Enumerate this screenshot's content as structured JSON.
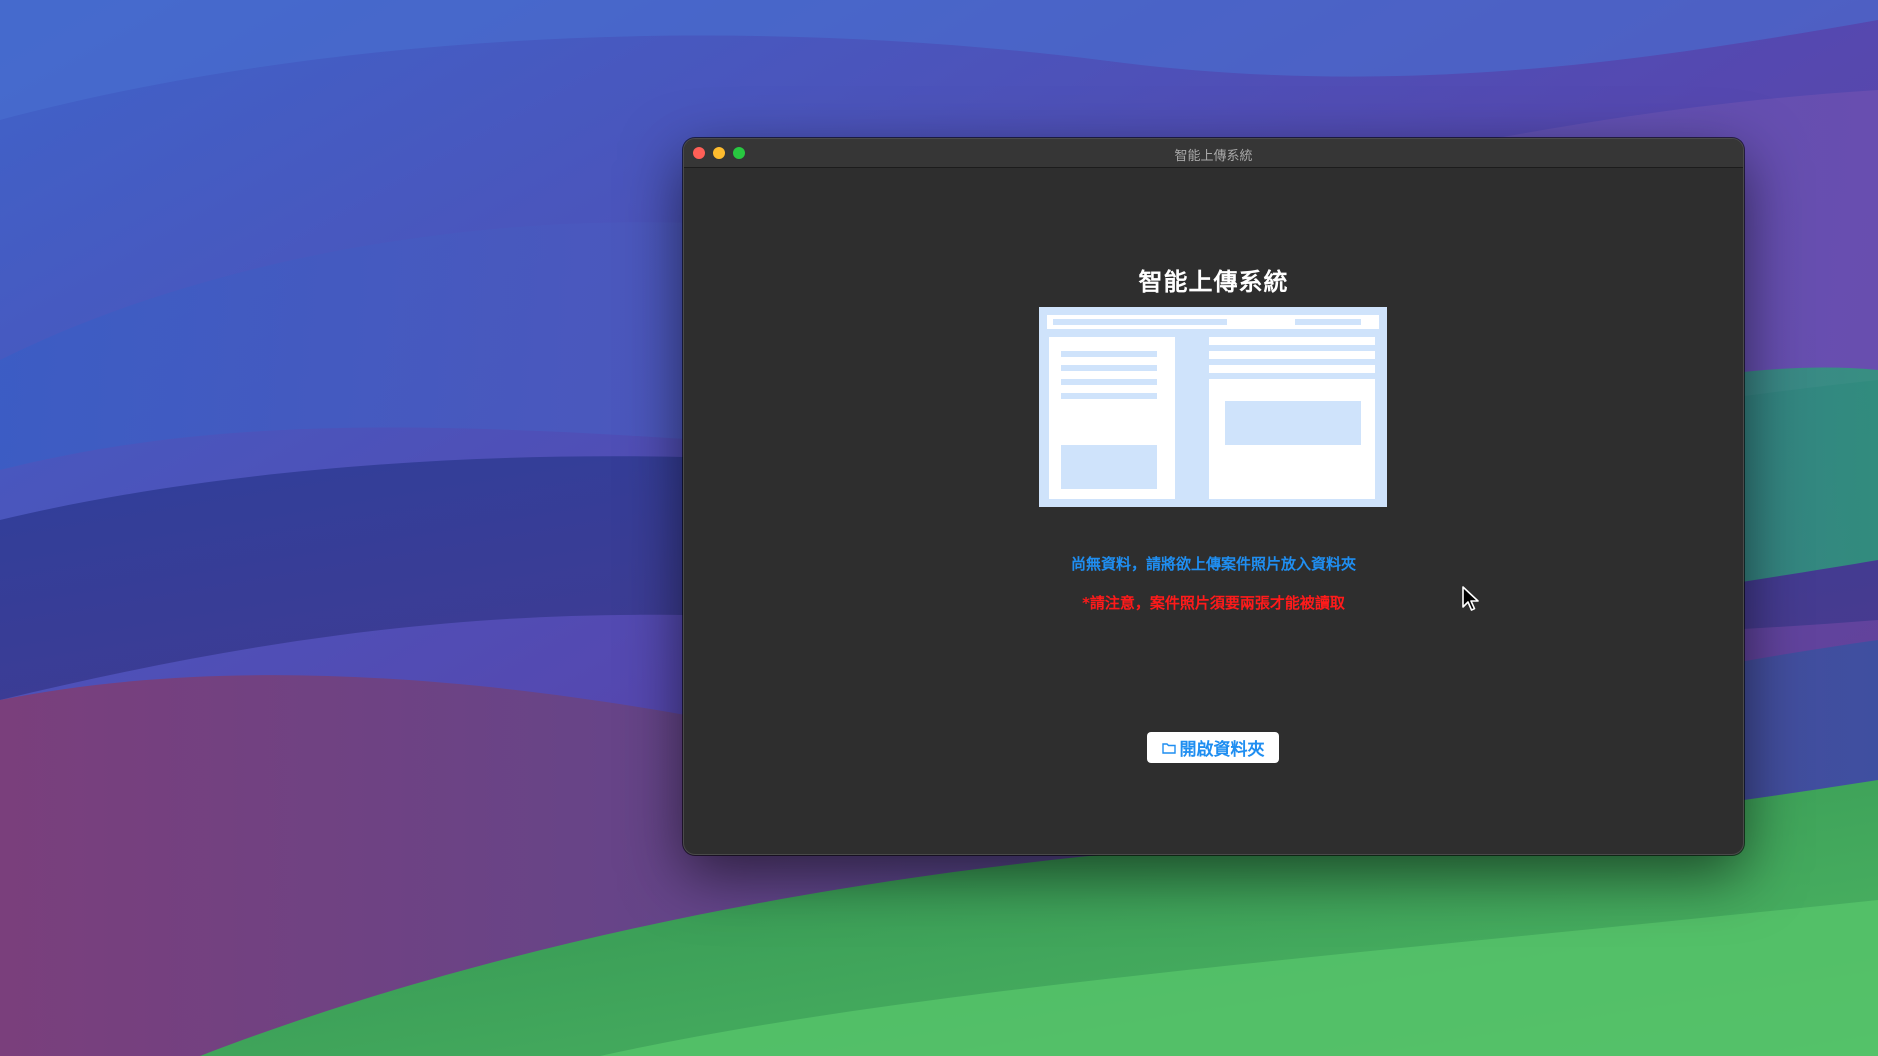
{
  "window": {
    "title": "智能上傳系統"
  },
  "main": {
    "heading": "智能上傳系統",
    "illustration_icon": "document-layout-illustration",
    "empty_message": "尚無資料，請將欲上傳案件照片放入資料夾",
    "warning_message": "*請注意，案件照片須要兩張才能被讀取",
    "open_folder_button": {
      "label": "開啟資料夾",
      "icon": "folder-icon"
    }
  },
  "colors": {
    "window_background": "#2e2e2e",
    "titlebar": "#363636",
    "accent_blue": "#1f8ef1",
    "warning_red": "#ff1a1a",
    "illustration_light": "#cfe3fb",
    "close": "#ff5f57",
    "minimize": "#febc2e",
    "maximize": "#28c840"
  }
}
